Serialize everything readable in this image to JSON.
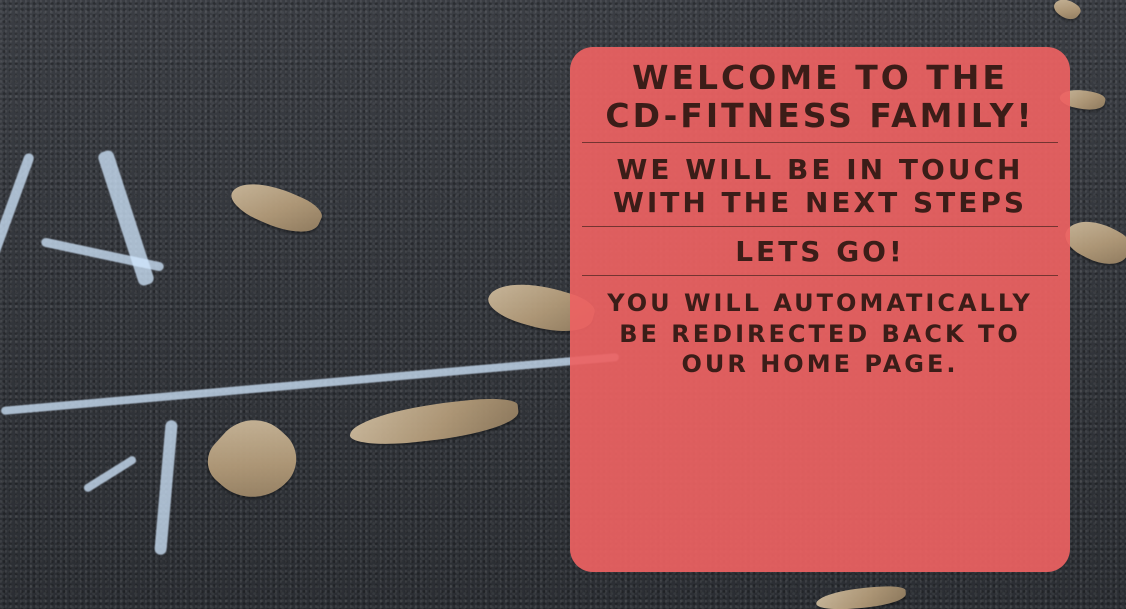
{
  "background": {
    "scene": "chalk-on-asphalt-with-leaves"
  },
  "card": {
    "title": "WELCOME TO THE CD-FITNESS FAMILY!",
    "subtitle": "WE WILL BE IN TOUCH WITH THE NEXT STEPS",
    "cta": "LETS GO!",
    "redirect_message": "YOU WILL AUTOMATICALLY BE REDIRECTED BACK TO OUR HOME PAGE."
  },
  "colors": {
    "card_background": "#ED6262",
    "card_text": "#3B1D18",
    "page_background": "#2F3136"
  }
}
